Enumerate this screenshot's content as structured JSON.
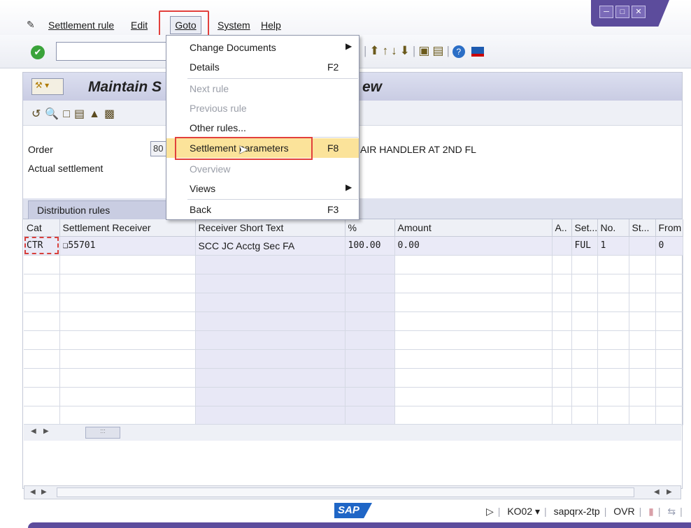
{
  "menubar": {
    "items": [
      "Settlement rule",
      "Edit",
      "Goto",
      "System",
      "Help"
    ]
  },
  "title": {
    "text_left": "Maintain S",
    "text_right": "ew"
  },
  "header": {
    "order_label": "Order",
    "order_value": "80",
    "actual_label": "Actual settlement",
    "order_description": "AIR HANDLER AT 2ND FL"
  },
  "table": {
    "tab_label": "Distribution rules",
    "columns": [
      "Cat",
      "Settlement Receiver",
      "Receiver Short Text",
      "%",
      "Amount",
      "A..",
      "Set...",
      "No.",
      "St...",
      "From"
    ],
    "rows": [
      [
        "CTR",
        "55701",
        "SCC JC Acctg Sec FA",
        "100.00",
        "0.00",
        "",
        "FUL",
        "1",
        "",
        "0"
      ]
    ]
  },
  "goto_menu": {
    "items": [
      {
        "label": "Change Documents",
        "key": "",
        "submenu": true,
        "disabled": false
      },
      {
        "label": "Details",
        "key": "F2",
        "submenu": false,
        "disabled": false
      },
      {
        "label": "Next rule",
        "key": "",
        "submenu": false,
        "disabled": true
      },
      {
        "label": "Previous rule",
        "key": "",
        "submenu": false,
        "disabled": true
      },
      {
        "label": "Other rules...",
        "key": "",
        "submenu": false,
        "disabled": false
      },
      {
        "label": "Settlement parameters",
        "key": "F8",
        "submenu": false,
        "disabled": false,
        "highlighted": true
      },
      {
        "label": "Overview",
        "key": "",
        "submenu": false,
        "disabled": true
      },
      {
        "label": "Views",
        "key": "",
        "submenu": true,
        "disabled": false
      },
      {
        "label": "Back",
        "key": "F3",
        "submenu": false,
        "disabled": false
      }
    ]
  },
  "status": {
    "logo": "SAP",
    "transaction": "KO02",
    "server": "sapqrx-2tp",
    "mode": "OVR"
  },
  "colors": {
    "accent": "#5c4c9c",
    "highlight_border": "#e2403c",
    "menu_highlight": "#fbe39a"
  }
}
